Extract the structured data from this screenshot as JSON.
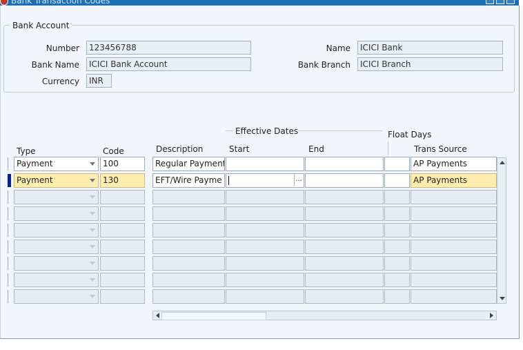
{
  "window": {
    "title": "Bank Transaction Codes"
  },
  "bank_account": {
    "legend": "Bank Account",
    "number_label": "Number",
    "number_value": "123456788",
    "bank_name_label": "Bank Name",
    "bank_name_value": "ICICI Bank Account",
    "currency_label": "Currency",
    "currency_value": "INR",
    "name_label": "Name",
    "name_value": "ICICI Bank",
    "bank_branch_label": "Bank Branch",
    "bank_branch_value": "ICICI Branch"
  },
  "table": {
    "effective_dates_label": "Effective Dates",
    "float_days_label": "Float Days",
    "headers": {
      "type": "Type",
      "code": "Code",
      "description": "Description",
      "start": "Start",
      "end": "End",
      "trans_source": "Trans Source"
    },
    "rows": [
      {
        "type": "Payment",
        "code": "100",
        "description": "Regular Payment",
        "start": "",
        "end": "",
        "float_days": "",
        "trans_source": "AP Payments"
      },
      {
        "type": "Payment",
        "code": "130",
        "description": "EFT/Wire Payme",
        "start": "",
        "end": "",
        "float_days": "",
        "trans_source": "AP Payments"
      },
      {
        "type": "",
        "code": "",
        "description": "",
        "start": "",
        "end": "",
        "float_days": "",
        "trans_source": ""
      },
      {
        "type": "",
        "code": "",
        "description": "",
        "start": "",
        "end": "",
        "float_days": "",
        "trans_source": ""
      },
      {
        "type": "",
        "code": "",
        "description": "",
        "start": "",
        "end": "",
        "float_days": "",
        "trans_source": ""
      },
      {
        "type": "",
        "code": "",
        "description": "",
        "start": "",
        "end": "",
        "float_days": "",
        "trans_source": ""
      },
      {
        "type": "",
        "code": "",
        "description": "",
        "start": "",
        "end": "",
        "float_days": "",
        "trans_source": ""
      },
      {
        "type": "",
        "code": "",
        "description": "",
        "start": "",
        "end": "",
        "float_days": "",
        "trans_source": ""
      },
      {
        "type": "",
        "code": "",
        "description": "",
        "start": "",
        "end": "",
        "float_days": "",
        "trans_source": ""
      }
    ]
  },
  "colors": {
    "title_bar": "#1d6fb5",
    "current_row": "#fdeeb0",
    "record_indicator": "#0c1f8f"
  }
}
